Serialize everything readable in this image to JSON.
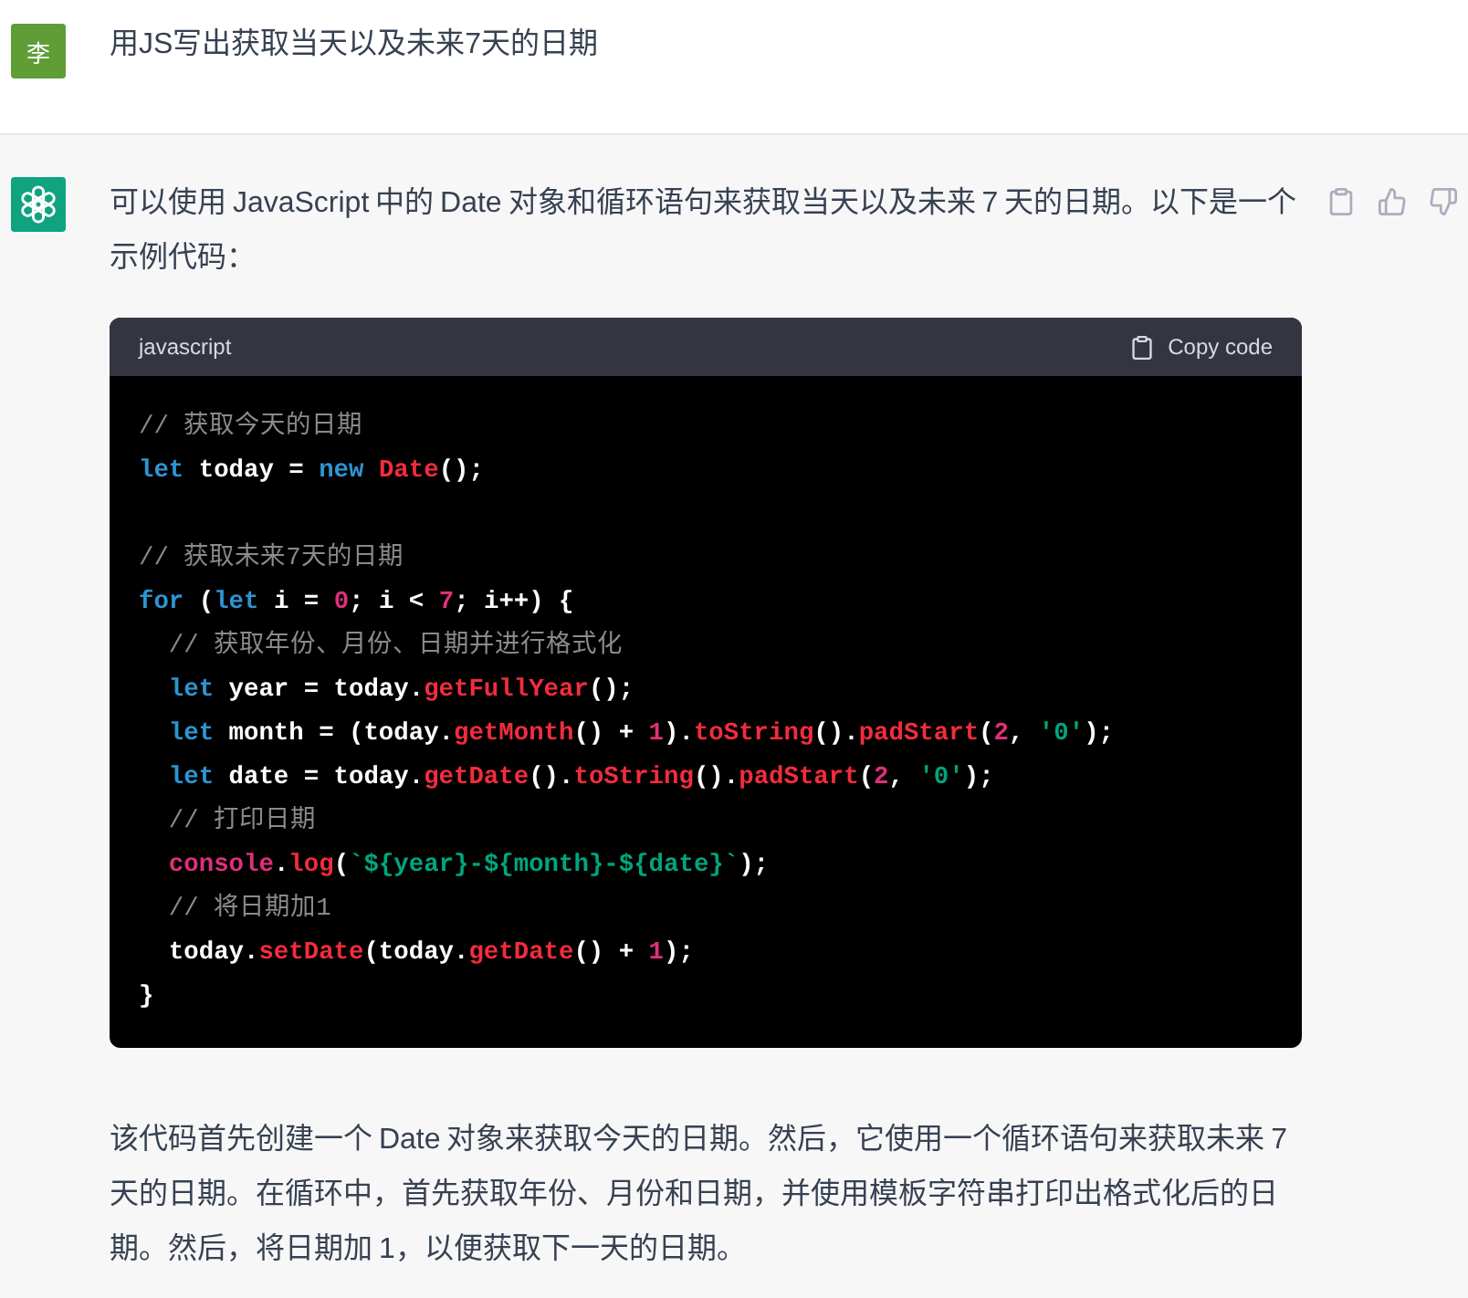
{
  "user_message": {
    "avatar_text": "李",
    "text": "用JS写出获取当天以及未来7天的日期"
  },
  "assistant_message": {
    "intro": "可以使用 JavaScript 中的 Date 对象和循环语句来获取当天以及未来 7 天的日期。以下是一个示例代码：",
    "code_block": {
      "language": "javascript",
      "copy_label": "Copy code",
      "lines": [
        {
          "kind": "code",
          "tokens": [
            {
              "text": "// 获取今天的日期",
              "kind": "comment"
            }
          ]
        },
        {
          "kind": "code",
          "tokens": [
            {
              "text": "let",
              "kind": "keyword"
            },
            {
              "text": " today = ",
              "kind": "plain"
            },
            {
              "text": "new ",
              "kind": "keyword"
            },
            {
              "text": "Date",
              "kind": "function"
            },
            {
              "text": "();",
              "kind": "plain"
            }
          ]
        },
        {
          "kind": "blank"
        },
        {
          "kind": "code",
          "tokens": [
            {
              "text": "// 获取未来7天的日期",
              "kind": "comment"
            }
          ]
        },
        {
          "kind": "code",
          "tokens": [
            {
              "text": "for",
              "kind": "keyword"
            },
            {
              "text": " (",
              "kind": "plain"
            },
            {
              "text": "let",
              "kind": "keyword"
            },
            {
              "text": " i = ",
              "kind": "plain"
            },
            {
              "text": "0",
              "kind": "number"
            },
            {
              "text": "; i < ",
              "kind": "plain"
            },
            {
              "text": "7",
              "kind": "number"
            },
            {
              "text": "; i++) {",
              "kind": "plain"
            }
          ]
        },
        {
          "kind": "code",
          "tokens": [
            {
              "text": "  // 获取年份、月份、日期并进行格式化",
              "kind": "comment"
            }
          ]
        },
        {
          "kind": "code",
          "tokens": [
            {
              "text": "  let",
              "kind": "keyword"
            },
            {
              "text": " year = today.",
              "kind": "plain"
            },
            {
              "text": "getFullYear",
              "kind": "function"
            },
            {
              "text": "();",
              "kind": "plain"
            }
          ]
        },
        {
          "kind": "code",
          "tokens": [
            {
              "text": "  let",
              "kind": "keyword"
            },
            {
              "text": " month = (today.",
              "kind": "plain"
            },
            {
              "text": "getMonth",
              "kind": "function"
            },
            {
              "text": "() + ",
              "kind": "plain"
            },
            {
              "text": "1",
              "kind": "number"
            },
            {
              "text": ").",
              "kind": "plain"
            },
            {
              "text": "toString",
              "kind": "function"
            },
            {
              "text": "().",
              "kind": "plain"
            },
            {
              "text": "padStart",
              "kind": "function"
            },
            {
              "text": "(",
              "kind": "plain"
            },
            {
              "text": "2",
              "kind": "number"
            },
            {
              "text": ", ",
              "kind": "plain"
            },
            {
              "text": "'0'",
              "kind": "string"
            },
            {
              "text": ");",
              "kind": "plain"
            }
          ]
        },
        {
          "kind": "code",
          "tokens": [
            {
              "text": "  let",
              "kind": "keyword"
            },
            {
              "text": " date = today.",
              "kind": "plain"
            },
            {
              "text": "getDate",
              "kind": "function"
            },
            {
              "text": "().",
              "kind": "plain"
            },
            {
              "text": "toString",
              "kind": "function"
            },
            {
              "text": "().",
              "kind": "plain"
            },
            {
              "text": "padStart",
              "kind": "function"
            },
            {
              "text": "(",
              "kind": "plain"
            },
            {
              "text": "2",
              "kind": "number"
            },
            {
              "text": ", ",
              "kind": "plain"
            },
            {
              "text": "'0'",
              "kind": "string"
            },
            {
              "text": ");",
              "kind": "plain"
            }
          ]
        },
        {
          "kind": "code",
          "tokens": [
            {
              "text": "  // 打印日期",
              "kind": "comment"
            }
          ]
        },
        {
          "kind": "code",
          "tokens": [
            {
              "text": "  console",
              "kind": "builtin"
            },
            {
              "text": ".",
              "kind": "plain"
            },
            {
              "text": "log",
              "kind": "function"
            },
            {
              "text": "(",
              "kind": "plain"
            },
            {
              "text": "`${year}-${month}-${date}`",
              "kind": "string"
            },
            {
              "text": ");",
              "kind": "plain"
            }
          ]
        },
        {
          "kind": "code",
          "tokens": [
            {
              "text": "  // 将日期加1",
              "kind": "comment"
            }
          ]
        },
        {
          "kind": "code",
          "tokens": [
            {
              "text": "  today.",
              "kind": "plain"
            },
            {
              "text": "setDate",
              "kind": "function"
            },
            {
              "text": "(today.",
              "kind": "plain"
            },
            {
              "text": "getDate",
              "kind": "function"
            },
            {
              "text": "() + ",
              "kind": "plain"
            },
            {
              "text": "1",
              "kind": "number"
            },
            {
              "text": ");",
              "kind": "plain"
            }
          ]
        },
        {
          "kind": "code",
          "tokens": [
            {
              "text": "}",
              "kind": "plain"
            }
          ]
        }
      ]
    },
    "outro": "该代码首先创建一个 Date 对象来获取今天的日期。然后，它使用一个循环语句来获取未来 7 天的日期。在循环中，首先获取年份、月份和日期，并使用模板字符串打印出格式化后的日期。然后，将日期加 1，以便获取下一天的日期。"
  }
}
